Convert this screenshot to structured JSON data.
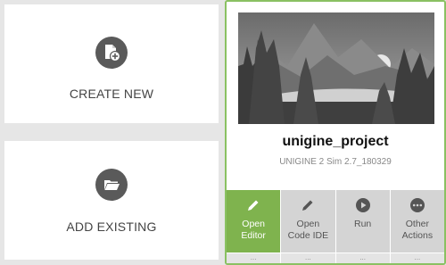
{
  "create": {
    "label": "CREATE NEW",
    "icon": "new-file-icon"
  },
  "add": {
    "label": "ADD EXISTING",
    "icon": "folder-open-icon"
  },
  "project": {
    "name": "unigine_project",
    "version": "UNIGINE 2 Sim 2.7_180329",
    "buttons": [
      {
        "label": "Open\nEditor",
        "icon": "pencil-icon",
        "more": "..."
      },
      {
        "label": "Open\nCode IDE",
        "icon": "pencil-icon",
        "more": "..."
      },
      {
        "label": "Run",
        "icon": "play-icon",
        "more": "..."
      },
      {
        "label": "Other\nActions",
        "icon": "more-dots-icon",
        "more": "..."
      }
    ]
  },
  "colors": {
    "accent": "#7fb34e",
    "border": "#8ac162",
    "icon_bg": "#5a5a5a"
  }
}
